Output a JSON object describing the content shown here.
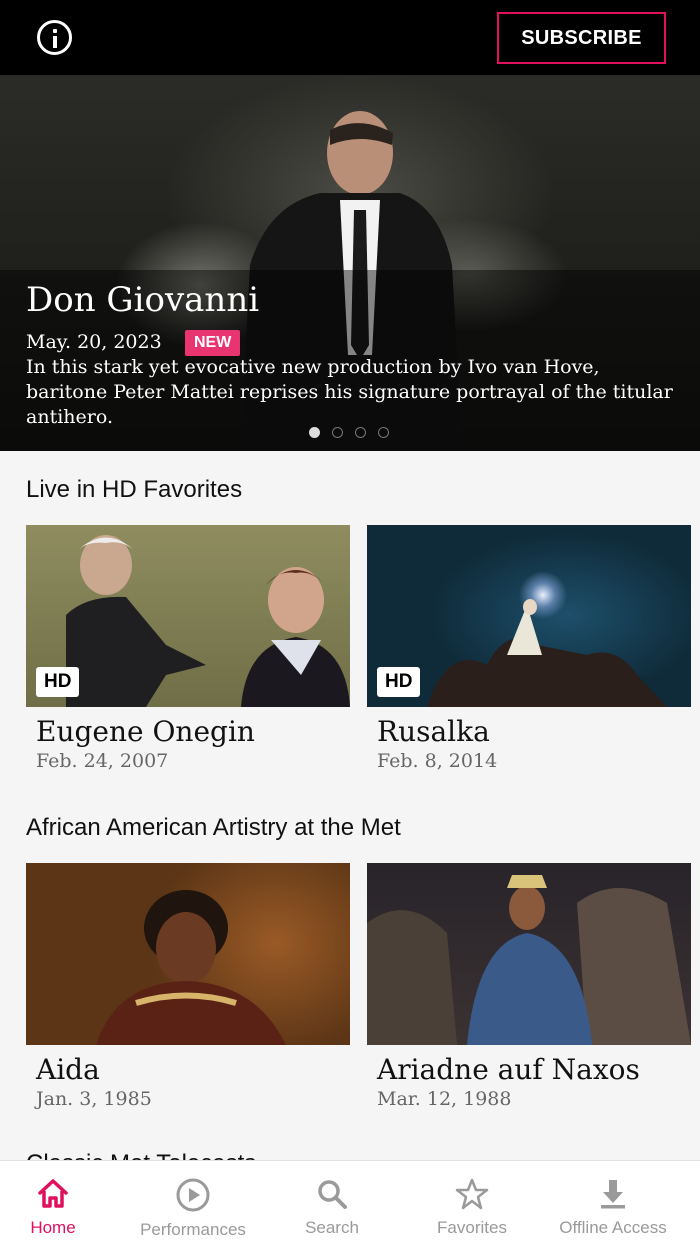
{
  "header": {
    "info_icon": "info-icon",
    "subscribe_label": "SUBSCRIBE",
    "accent_color": "#e0105f"
  },
  "hero": {
    "title": "Don Giovanni",
    "date": "May. 20, 2023",
    "badge": "NEW",
    "description": "In this stark yet evocative new production by Ivo van Hove, baritone Peter Mattei reprises his signature portrayal of the titular antihero.",
    "carousel_count": 4,
    "carousel_active": 1
  },
  "sections": [
    {
      "title": "Live in HD Favorites",
      "items": [
        {
          "title": "Eugene Onegin",
          "date": "Feb. 24, 2007",
          "badge": "HD"
        },
        {
          "title": "Rusalka",
          "date": "Feb. 8, 2014",
          "badge": "HD"
        }
      ]
    },
    {
      "title": "African American Artistry at the Met",
      "items": [
        {
          "title": "Aida",
          "date": "Jan. 3, 1985"
        },
        {
          "title": "Ariadne auf Naxos",
          "date": "Mar. 12, 1988"
        }
      ]
    },
    {
      "title": "Classic Met Telecasts"
    }
  ],
  "nav": {
    "items": [
      {
        "label": "Home",
        "icon": "home-icon",
        "active": true
      },
      {
        "label": "Performances",
        "icon": "play-circle-icon"
      },
      {
        "label": "Search",
        "icon": "search-icon"
      },
      {
        "label": "Favorites",
        "icon": "star-icon"
      },
      {
        "label": "Offline Access",
        "icon": "download-icon"
      }
    ]
  }
}
